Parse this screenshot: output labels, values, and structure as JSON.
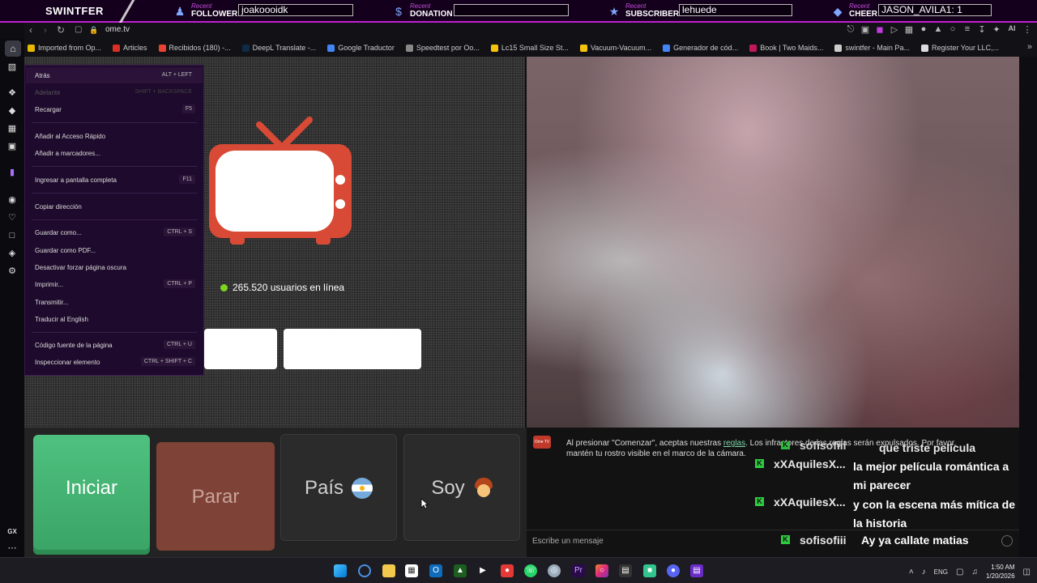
{
  "overlay": {
    "brand": "SWINTFER",
    "recent_label": "Recent",
    "follower": {
      "label": "FOLLOWER",
      "value": "joakoooidk"
    },
    "donation": {
      "label": "DONATION",
      "value": ""
    },
    "subscriber": {
      "label": "SUBSCRIBER",
      "value": "lehuede"
    },
    "cheer": {
      "label": "CHEER",
      "value": "JASON_AVILA1: 1"
    }
  },
  "browser": {
    "url": "ome.tv",
    "ai_label": "AI"
  },
  "bookmarks": [
    {
      "label": "Imported from Op...",
      "color": "#e6b800"
    },
    {
      "label": "Articles",
      "color": "#d93025"
    },
    {
      "label": "Recibidos (180) -...",
      "color": "#ea4335"
    },
    {
      "label": "DeepL Translate -...",
      "color": "#0f2b46"
    },
    {
      "label": "Google Traductor",
      "color": "#4285f4"
    },
    {
      "label": "Speedtest por Oo...",
      "color": "#888888"
    },
    {
      "label": "Lc15 Small Size St...",
      "color": "#f4c20d"
    },
    {
      "label": "Vacuum-Vacuum...",
      "color": "#f4c20d"
    },
    {
      "label": "Generador de cód...",
      "color": "#4285f4"
    },
    {
      "label": "Book | Two Maids...",
      "color": "#c2185b"
    },
    {
      "label": "swintfer - Main Pa...",
      "color": "#cccccc"
    },
    {
      "label": "Register Your LLC,...",
      "color": "#dddddd"
    }
  ],
  "context_menu": {
    "items": [
      {
        "label": "Atrás",
        "shortcut": "ALT + LEFT",
        "disabled": false
      },
      {
        "label": "Adelante",
        "shortcut": "SHIFT + BACKSPACE",
        "disabled": true
      },
      {
        "label": "Recargar",
        "shortcut": "F5",
        "disabled": false
      },
      {
        "label": "Añadir al Acceso Rápido",
        "shortcut": "",
        "disabled": false
      },
      {
        "label": "Añadir a marcadores...",
        "shortcut": "",
        "disabled": false
      },
      {
        "label": "Ingresar a pantalla completa",
        "shortcut": "F11",
        "disabled": false
      },
      {
        "label": "Copiar dirección",
        "shortcut": "",
        "disabled": false
      },
      {
        "label": "Guardar como...",
        "shortcut": "CTRL + S",
        "disabled": false
      },
      {
        "label": "Guardar como PDF...",
        "shortcut": "",
        "disabled": false
      },
      {
        "label": "Desactivar forzar página oscura",
        "shortcut": "",
        "disabled": false
      },
      {
        "label": "Imprimir...",
        "shortcut": "CTRL + P",
        "disabled": false
      },
      {
        "label": "Transmitir...",
        "shortcut": "",
        "disabled": false
      },
      {
        "label": "Traducir al English",
        "shortcut": "",
        "disabled": false
      },
      {
        "label": "Código fuente de la página",
        "shortcut": "CTRL + U",
        "disabled": false
      },
      {
        "label": "Inspeccionar elemento",
        "shortcut": "CTRL + SHIFT + C",
        "disabled": false
      }
    ]
  },
  "ometv": {
    "online_text": "265.520 usuarios en línea",
    "start_button": "Iniciar",
    "stop_button": "Parar",
    "country_button": "País",
    "gender_button": "Soy"
  },
  "chat": {
    "logo_text": "Ome TV",
    "notice_before": "Al presionar \"Comenzar\", aceptas nuestras ",
    "notice_link": "reglas",
    "notice_after": ". Los infractores de las reglas serán expulsados. Por favor, mantén tu rostro visible en el marco de la cámara.",
    "overlay_messages": [
      {
        "user": "xXAquilesX...",
        "message": "la mejor película romántica a mi parecer"
      },
      {
        "user": "xXAquilesX...",
        "message": "y con la escena más mítica de la historia"
      },
      {
        "user": "sofisofiii",
        "message": "Ay ya callate matias"
      }
    ],
    "hidden_partial": {
      "user": "sofisofiii",
      "message": "que triste película"
    },
    "input_placeholder": "Escribe un mensaje"
  },
  "taskbar": {
    "lang": "ENG",
    "time": "1:50 AM",
    "date": "1/20/2026"
  },
  "sidebar_label": "GX"
}
